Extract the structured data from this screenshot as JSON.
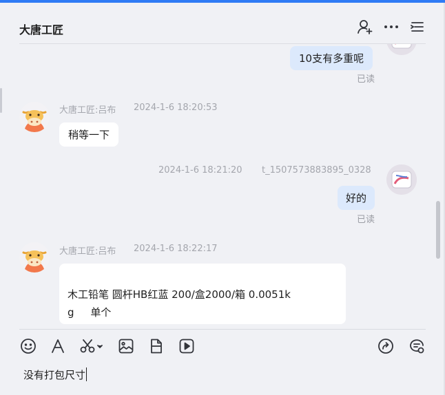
{
  "header": {
    "title": "大唐工匠",
    "icons": [
      "add-user-icon",
      "more-icon",
      "list-menu-icon"
    ]
  },
  "messages": [
    {
      "direction": "out",
      "text": "10支有多重呢",
      "read_label": "已读"
    },
    {
      "direction": "in",
      "sender": "大唐工匠:吕布",
      "time": "2024-1-6 18:20:53",
      "text": "稍等一下"
    },
    {
      "direction": "out",
      "sender": "t_1507573883895_0328",
      "time": "2024-1-6 18:21:20",
      "text": "好的",
      "read_label": "已读"
    },
    {
      "direction": "in",
      "sender": "大唐工匠:吕布",
      "time": "2024-1-6 18:22:17",
      "lines": [
        "木工铅笔 圆杆HB红蓝   200/盒2000/箱   0.0051k",
        "g     单个"
      ]
    }
  ],
  "toolbar": {
    "icons": [
      "emoji-icon",
      "font-icon",
      "screenshot-scissors-icon",
      "image-icon",
      "file-icon",
      "video-icon",
      "share-icon",
      "chat-history-icon"
    ]
  },
  "composer": {
    "value": "没有打包尺寸"
  },
  "colors": {
    "accent": "#2f7bf5",
    "background": "#f0f1f5",
    "bubble_out": "#dce9fc",
    "bubble_in": "#ffffff"
  }
}
